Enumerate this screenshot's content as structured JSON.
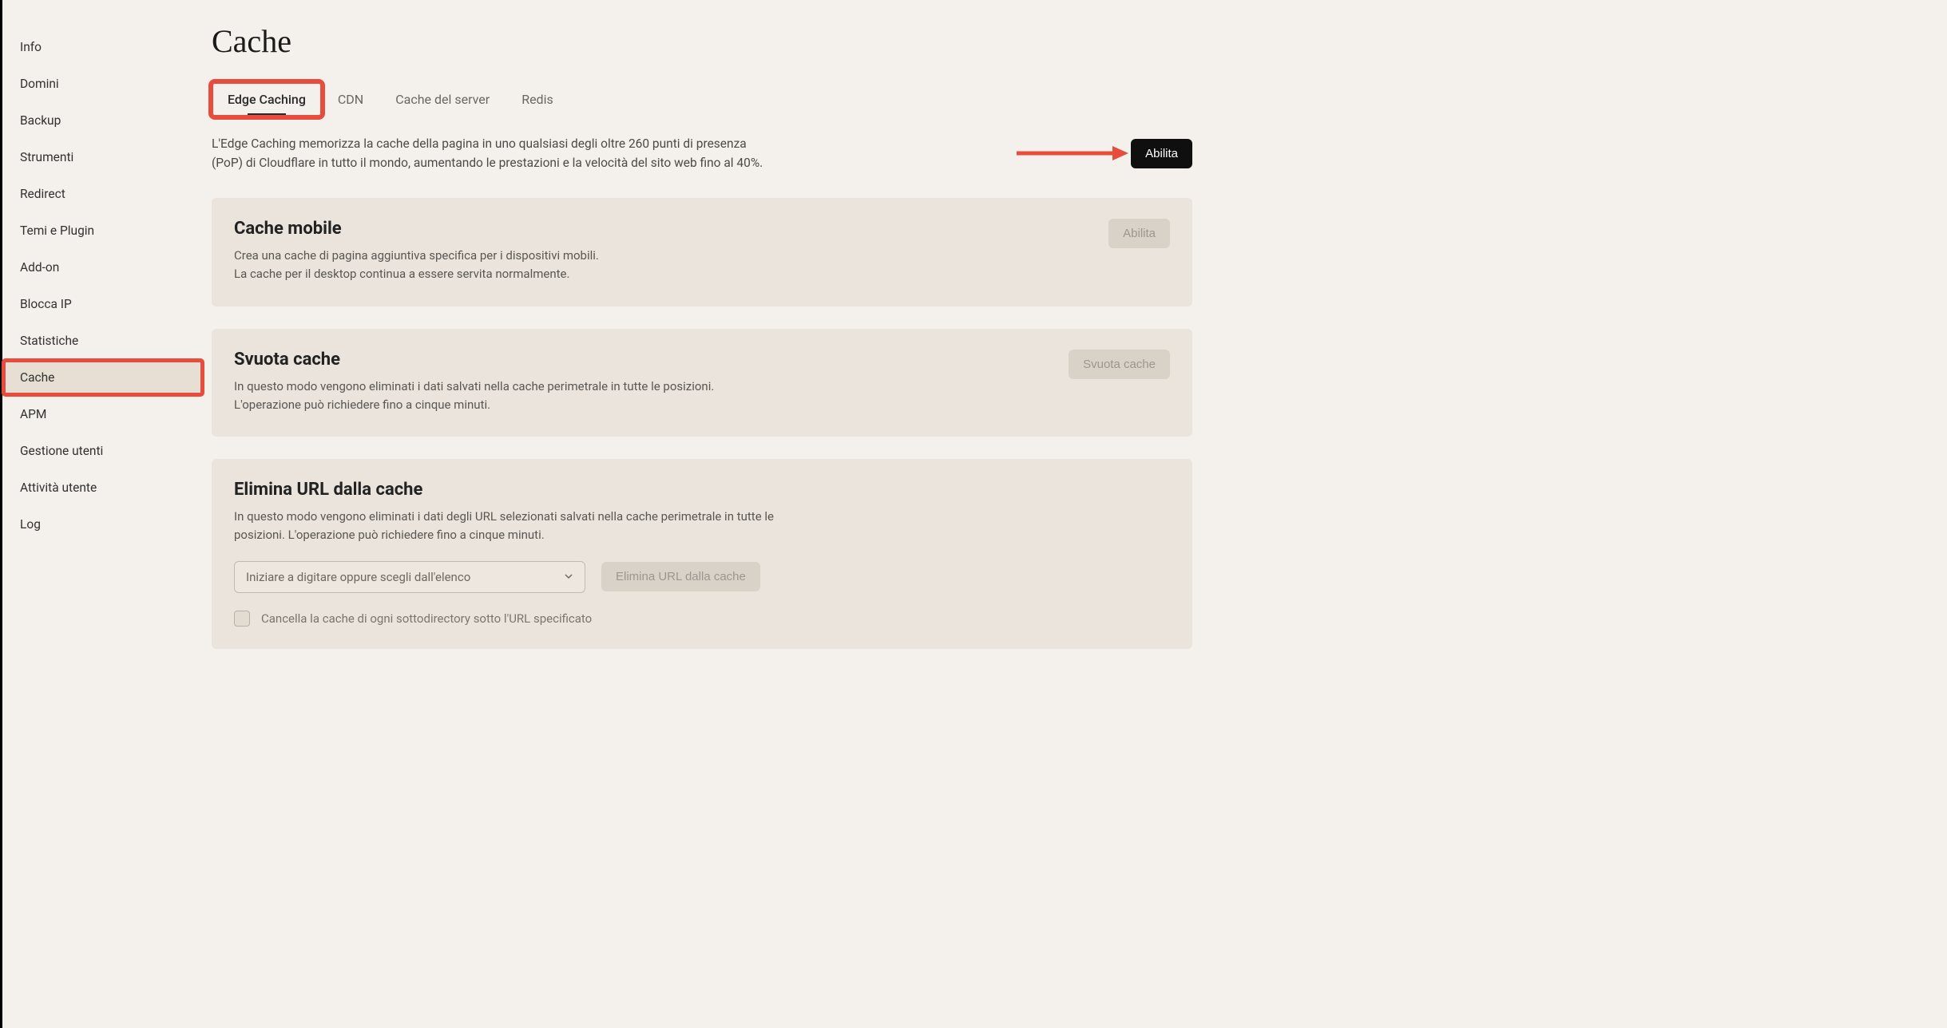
{
  "sidebar": {
    "items": [
      {
        "label": "Info",
        "active": false,
        "highlighted": false
      },
      {
        "label": "Domini",
        "active": false,
        "highlighted": false
      },
      {
        "label": "Backup",
        "active": false,
        "highlighted": false
      },
      {
        "label": "Strumenti",
        "active": false,
        "highlighted": false
      },
      {
        "label": "Redirect",
        "active": false,
        "highlighted": false
      },
      {
        "label": "Temi e Plugin",
        "active": false,
        "highlighted": false
      },
      {
        "label": "Add-on",
        "active": false,
        "highlighted": false
      },
      {
        "label": "Blocca IP",
        "active": false,
        "highlighted": false
      },
      {
        "label": "Statistiche",
        "active": false,
        "highlighted": false
      },
      {
        "label": "Cache",
        "active": true,
        "highlighted": true
      },
      {
        "label": "APM",
        "active": false,
        "highlighted": false
      },
      {
        "label": "Gestione utenti",
        "active": false,
        "highlighted": false
      },
      {
        "label": "Attività utente",
        "active": false,
        "highlighted": false
      },
      {
        "label": "Log",
        "active": false,
        "highlighted": false
      }
    ]
  },
  "page": {
    "title": "Cache"
  },
  "tabs": [
    {
      "label": "Edge Caching",
      "active": true,
      "highlighted": true
    },
    {
      "label": "CDN",
      "active": false,
      "highlighted": false
    },
    {
      "label": "Cache del server",
      "active": false,
      "highlighted": false
    },
    {
      "label": "Redis",
      "active": false,
      "highlighted": false
    }
  ],
  "intro": {
    "text": "L'Edge Caching memorizza la cache della pagina in uno qualsiasi degli oltre 260 punti di presenza (PoP) di Cloudflare in tutto il mondo, aumentando le prestazioni e la velocità del sito web fino al 40%.",
    "button": "Abilita"
  },
  "cards": {
    "mobile": {
      "title": "Cache mobile",
      "desc1": "Crea una cache di pagina aggiuntiva specifica per i dispositivi mobili.",
      "desc2": "La cache per il desktop continua a essere servita normalmente.",
      "button": "Abilita"
    },
    "clear": {
      "title": "Svuota cache",
      "desc1": "In questo modo vengono eliminati i dati salvati nella cache perimetrale in tutte le posizioni.",
      "desc2": "L'operazione può richiedere fino a cinque minuti.",
      "button": "Svuota cache"
    },
    "purge": {
      "title": "Elimina URL dalla cache",
      "desc": "In questo modo vengono eliminati i dati degli URL selezionati salvati nella cache perimetrale in tutte le posizioni. L'operazione può richiedere fino a cinque minuti.",
      "select_placeholder": "Iniziare a digitare oppure scegli dall'elenco",
      "button": "Elimina URL dalla cache",
      "checkbox_label": "Cancella la cache di ogni sottodirectory sotto l'URL specificato"
    }
  },
  "annotations": {
    "arrow_color": "#e74c3c",
    "highlight_color": "#e74c3c"
  }
}
